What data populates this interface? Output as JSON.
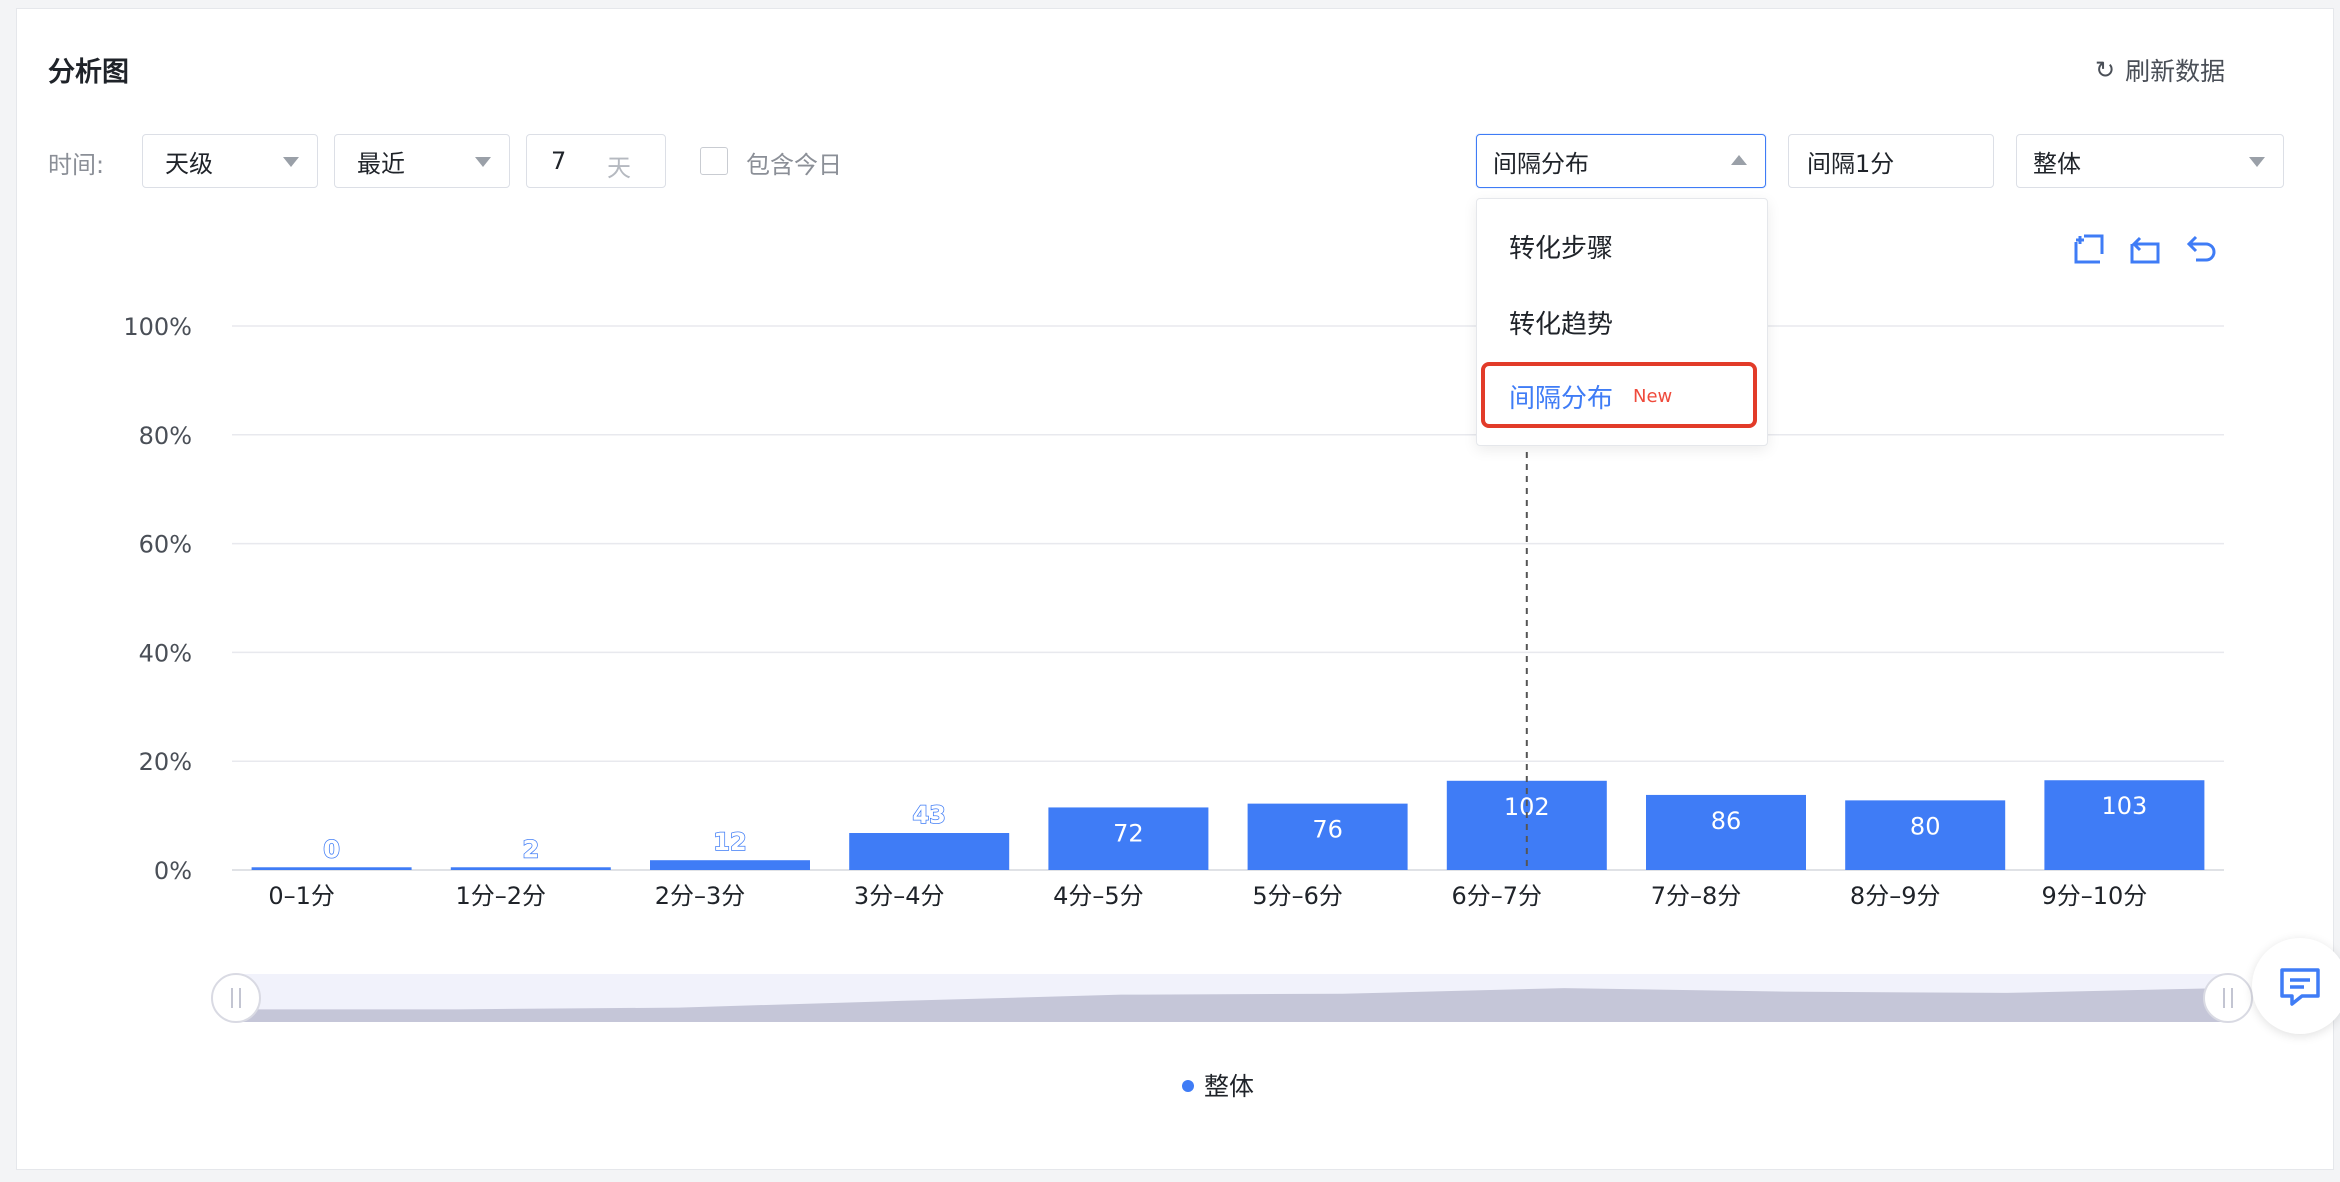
{
  "header": {
    "title": "分析图",
    "refresh_label": "刷新数据"
  },
  "filters": {
    "time_label": "时间:",
    "granularity": "天级",
    "range": "最近",
    "days_value": "7",
    "days_unit": "天",
    "include_today_label": "包含今日",
    "include_today_checked": false
  },
  "controls": {
    "analysis_type": "间隔分布",
    "interval": "间隔1分",
    "group": "整体"
  },
  "dropdown": {
    "options": [
      {
        "label": "转化步骤",
        "badge": ""
      },
      {
        "label": "转化趋势",
        "badge": ""
      },
      {
        "label": "间隔分布",
        "badge": "New"
      }
    ],
    "selected_index": 2
  },
  "toolbar_icons": [
    "zoom-select-icon",
    "zoom-reset-icon",
    "undo-icon"
  ],
  "colors": {
    "bar": "#3f7cf6",
    "accent": "#3f7cf6",
    "highlight_border": "#e23b29",
    "badge_new": "#ef4b3c",
    "slider_fill": "#c5c6d8",
    "slider_bg": "#f1f2fb"
  },
  "chart_data": {
    "type": "bar",
    "categories": [
      "0–1分",
      "1分–2分",
      "2分–3分",
      "3分–4分",
      "4分–5分",
      "5分–6分",
      "6分–7分",
      "7分–8分",
      "8分–9分",
      "9分–10分"
    ],
    "series": [
      {
        "name": "整体",
        "counts": [
          0,
          2,
          12,
          43,
          72,
          76,
          102,
          86,
          80,
          103
        ],
        "percent": [
          0.5,
          0.5,
          1.8,
          6.8,
          11.5,
          12.2,
          16.4,
          13.8,
          12.8,
          16.5
        ]
      }
    ],
    "y_ticks": [
      "0%",
      "20%",
      "40%",
      "60%",
      "80%",
      "100%"
    ],
    "ylim": [
      0,
      100
    ],
    "grid": true,
    "legend": "bottom-center",
    "hover_category_index": 6
  }
}
